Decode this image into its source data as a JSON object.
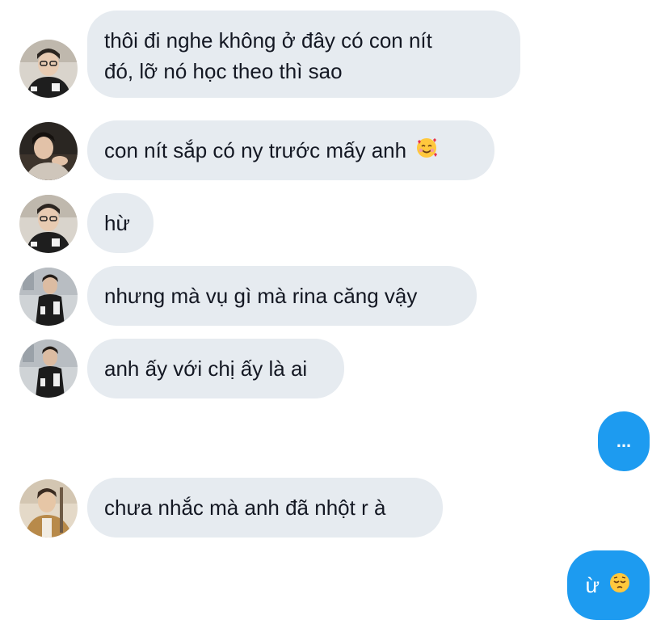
{
  "conversation": {
    "messages": [
      {
        "sender": "incoming",
        "avatar_icon": "avatar-user-1-icon",
        "lines": [
          "thôi đi nghe không ở đây có con nít",
          "đó, lỡ nó học theo thì sao"
        ]
      },
      {
        "sender": "incoming",
        "avatar_icon": "avatar-user-2-icon",
        "text": "con nít sắp có ny trước mấy anh",
        "emoji_icon": "smiling-face-with-hearts-icon"
      },
      {
        "sender": "incoming",
        "avatar_icon": "avatar-user-1-icon",
        "text": "hừ"
      },
      {
        "sender": "incoming",
        "avatar_icon": "avatar-user-3-icon",
        "text": "nhưng mà vụ gì mà rina căng vậy"
      },
      {
        "sender": "incoming",
        "avatar_icon": "avatar-user-3-icon",
        "text": "anh ấy với chị ấy là ai"
      },
      {
        "sender": "outgoing",
        "text": "..."
      },
      {
        "sender": "incoming",
        "avatar_icon": "avatar-user-4-icon",
        "text": "chưa nhắc mà anh đã nhột r à"
      },
      {
        "sender": "outgoing",
        "text": "ừ",
        "emoji_icon": "pensive-face-icon"
      }
    ]
  },
  "colors": {
    "incoming_bubble": "#e6ebf0",
    "outgoing_bubble": "#1d9bf0",
    "incoming_text": "#141823",
    "outgoing_text": "#ffffff"
  }
}
